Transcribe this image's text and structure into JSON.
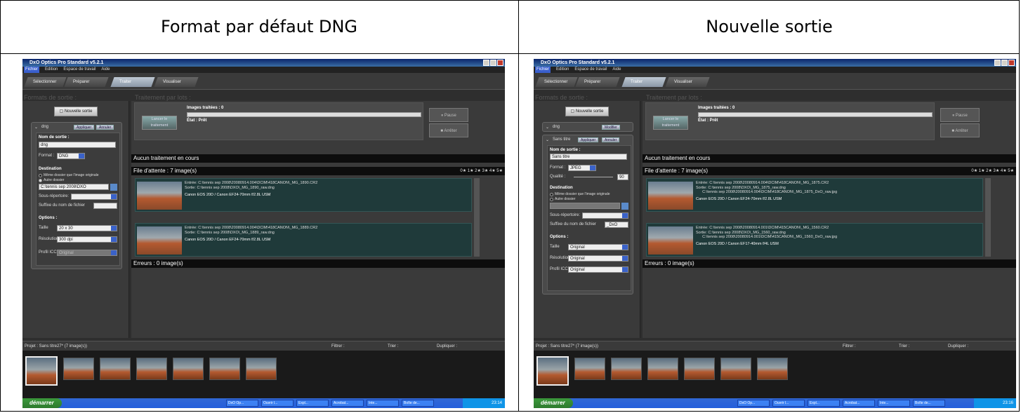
{
  "headers": {
    "left": "Format par défaut DNG",
    "right": "Nouvelle sortie"
  },
  "app": {
    "title": "DxO Optics Pro Standard v5.2.1",
    "menu": [
      "Fichier",
      "Edition",
      "Espace de travail",
      "Aide"
    ],
    "steps": [
      "Sélectionner",
      "Préparer",
      "Traiter",
      "Visualiser"
    ],
    "formats_title": "Formats de sortie :",
    "batch_title": "Traitement par lots :",
    "new_output_btn": "Nouvelle sortie",
    "launch_btn": "Lancer le traitement",
    "images_processed": "Images traitées :",
    "images_count": "0",
    "state_label": "État :",
    "state_value": "Prêt",
    "pause_btn": "Pause",
    "stop_btn": "Arrêter",
    "no_processing": "Aucun traitement en cours",
    "queue_label": "File d'attente : 7 image(s)",
    "errors_label": "Erreurs : 0 image(s)",
    "stars": "0★ 1★ 2★ 3★ 4★ 5★",
    "project": "Projet : Sans titre27* (7 image(s))",
    "filter": "Filtrer :",
    "sort": "Trier :",
    "duplicate": "Dupliquer :",
    "start": "démarrer",
    "entree": "Entrée:",
    "sortie": "Sortie:"
  },
  "left": {
    "format_name": "dng",
    "apply": "Appliquer",
    "cancel": "Annuler",
    "output_name_label": "Nom de sortie :",
    "output_name": "dng",
    "format_label": "Format :",
    "format_value": "DNG",
    "destination_label": "Destination",
    "same_folder": "Même dossier que l'image originale",
    "other_folder": "Autre dossier",
    "folder_path": "C:\\tennis sep 2008\\DXO",
    "subdir_label": "Sous-répertoire:",
    "suffix_label": "Suffixe du nom de fichier",
    "suffix_value": "",
    "options_label": "Options :",
    "size_label": "Taille",
    "size_value": "20 x 30",
    "res_label": "Résolution",
    "res_value": "300 dpi",
    "icc_label": "Profil ICC",
    "icc_value": "Original",
    "queue": [
      {
        "in": "C:\\tennis sep 2008\\20080914.004\\DCIM\\418CANON\\_MG_1890.CR2",
        "out": [
          "C:\\tennis sep 2008\\DXO\\_MG_1890_raw.dng"
        ],
        "cam": "Canon EOS 20D / Canon EF24-70mm f/2.8L USM"
      },
      {
        "in": "C:\\tennis sep 2008\\20080914.004\\DCIM\\418CANON\\_MG_1889.CR2",
        "out": [
          "C:\\tennis sep 2008\\DXO\\_MG_1889_raw.dng"
        ],
        "cam": "Canon EOS 20D / Canon EF24-70mm f/2.8L USM"
      }
    ],
    "taskbar": [
      "DxO Op...",
      "Ouvrir l...",
      "Expl...",
      "Acrobat...",
      "Inte...",
      "Boîte de..."
    ],
    "clock": "23:14"
  },
  "right": {
    "format_name": "dng",
    "modify": "Modifier",
    "new_name": "Sans titre",
    "apply": "Appliquer",
    "cancel": "Annuler",
    "output_name_label": "Nom de sortie :",
    "output_name": "Sans titre",
    "format_label": "Format :",
    "format_value": "JPEG",
    "quality_label": "Qualité :",
    "quality_value": "90",
    "destination_label": "Destination",
    "same_folder": "Même dossier que l'image originale",
    "other_folder": "Autre dossier",
    "subdir_label": "Sous-répertoire:",
    "suffix_label": "Suffixe du nom de fichier",
    "suffix_value": "_DxO",
    "options_label": "Options :",
    "size_label": "Taille",
    "size_value": "Original",
    "res_label": "Résolution",
    "res_value": "Original",
    "icc_label": "Profil ICC",
    "icc_value": "Original",
    "queue": [
      {
        "in": "C:\\tennis sep 2008\\20080914.004\\DCIM\\418CANON\\_MG_1875.CR2",
        "out": [
          "C:\\tennis sep 2008\\DXO\\_MG_1875_raw.dng",
          "C:\\tennis sep 2008\\20080914.004\\DCIM\\418CANON\\_MG_1875_DxO_raw.jpg"
        ],
        "cam": "Canon EOS 20D / Canon EF24-70mm f/2.8L USM"
      },
      {
        "in": "C:\\tennis sep 2008\\20080914.001\\DCIM\\415CANON\\_MG_1560.CR2",
        "out": [
          "C:\\tennis sep 2008\\DXO\\_MG_1560_raw.dng",
          "C:\\tennis sep 2008\\20080914.001\\DCIM\\415CANON\\_MG_1560_DxO_raw.jpg"
        ],
        "cam": "Canon EOS 20D / Canon EF17-40mm f/4L USM"
      }
    ],
    "taskbar": [
      "DxO Op...",
      "Ouvrir l...",
      "Expl...",
      "Acrobat...",
      "Inte...",
      "Boîte de..."
    ],
    "clock": "23:16"
  }
}
